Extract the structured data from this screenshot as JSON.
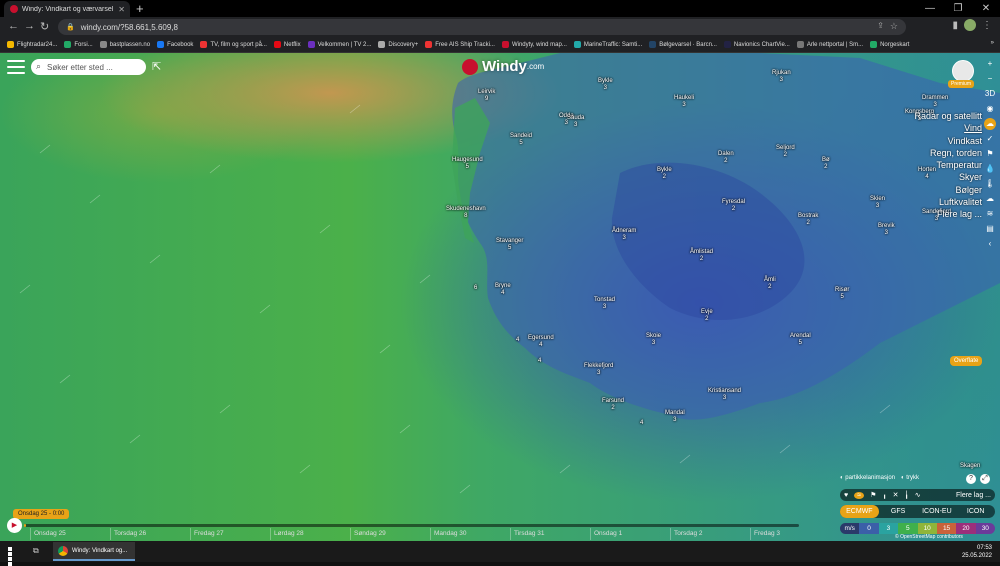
{
  "browser": {
    "tab_title": "Windy: Vindkart og værvarsel",
    "new_tab": "+",
    "url": "windy.com/?58.661,5.609,8",
    "window_controls": [
      "—",
      "❐",
      "✕"
    ],
    "bookmarks": [
      {
        "label": "Flightradar24...",
        "color": "#f5b800"
      },
      {
        "label": "Forsi...",
        "color": "#2a6"
      },
      {
        "label": "bastplassen.no",
        "color": "#888"
      },
      {
        "label": "Facebook",
        "color": "#1877f2"
      },
      {
        "label": "TV, film og sport på...",
        "color": "#e33"
      },
      {
        "label": "Netflix",
        "color": "#e50914"
      },
      {
        "label": "Velkommen | TV 2...",
        "color": "#6b2fbf"
      },
      {
        "label": "Discovery+",
        "color": "#aaa"
      },
      {
        "label": "Free AIS Ship Tracki...",
        "color": "#e33"
      },
      {
        "label": "Windyty, wind map...",
        "color": "#c8102e"
      },
      {
        "label": "MarineTraffic: Samti...",
        "color": "#2aa"
      },
      {
        "label": "Bølgevarsel · Barcn...",
        "color": "#246"
      },
      {
        "label": "Navionics ChartVie...",
        "color": "#224"
      },
      {
        "label": "Arle nettportal | Sm...",
        "color": "#777"
      },
      {
        "label": "Norgeskart",
        "color": "#2a6"
      }
    ],
    "other_bookmarks": "»"
  },
  "app": {
    "search_placeholder": "Søker etter sted ...",
    "logo_text": "Windy",
    "logo_suffix": ".com",
    "premium_label": "Premium",
    "menu": [
      "Radar og satellitt",
      "Vind",
      "Vindkast",
      "Regn, torden",
      "Temperatur",
      "Skyer",
      "Bølger",
      "Luftkvalitet",
      "Flere lag ..."
    ],
    "right_icons": [
      "+",
      "−",
      "3D",
      "◉",
      "☁",
      "✓",
      "⚑",
      "💧",
      "🌡",
      "☁",
      "≋",
      "▤",
      "‹"
    ],
    "overflate": "Overflate",
    "particle_label": "partikkelanimasjon",
    "pressure_label": "trykk",
    "layers_label": "Flere lag ...",
    "models": [
      "ECMWF",
      "GFS",
      "ICON-EU",
      "ICON"
    ],
    "selected_model": "ECMWF",
    "legend": {
      "unit": "m/s",
      "values": [
        "0",
        "3",
        "5",
        "10",
        "15",
        "20",
        "30"
      ],
      "colors": [
        "#3b5fa8",
        "#3b79c3",
        "#2aa3a0",
        "#3fb04c",
        "#c7b83a",
        "#c8623a",
        "#9b2f7b",
        "#6b3b9a"
      ]
    },
    "attribution": "© OpenStreetMap contributors",
    "timeline": {
      "current": "Onsdag 25 - 0:00",
      "days": [
        "Onsdag 25",
        "Torsdag 26",
        "Fredag 27",
        "Lørdag 28",
        "Søndag 29",
        "Mandag 30",
        "Tirsdag 31",
        "Onsdag 1",
        "Torsdag 2",
        "Fredag 3"
      ]
    }
  },
  "map_labels": [
    {
      "name": "Bykle",
      "val": "3"
    },
    {
      "name": "Rjukan",
      "val": "3"
    },
    {
      "name": "Haukeli",
      "val": "3"
    },
    {
      "name": "Leirvik",
      "val": "9"
    },
    {
      "name": "Odda",
      "val": "3"
    },
    {
      "name": "Sauda",
      "val": "3"
    },
    {
      "name": "Sandeid",
      "val": "5"
    },
    {
      "name": "Haugesund",
      "val": "5"
    },
    {
      "name": "Dalen",
      "val": "2"
    },
    {
      "name": "Seljord",
      "val": "2"
    },
    {
      "name": "Bø",
      "val": "2"
    },
    {
      "name": "Bykle",
      "val": "2"
    },
    {
      "name": "Skudeneshavn",
      "val": "8"
    },
    {
      "name": "Stavanger",
      "val": "5"
    },
    {
      "name": "Fyresdal",
      "val": "2"
    },
    {
      "name": "Bostrak",
      "val": "2"
    },
    {
      "name": "Skien",
      "val": "3"
    },
    {
      "name": "Ådneram",
      "val": "3"
    },
    {
      "name": "Åmlistad",
      "val": "2"
    },
    {
      "name": "Bryne",
      "val": "4"
    },
    {
      "name": "Åmli",
      "val": "2"
    },
    {
      "name": "Risør",
      "val": "5"
    },
    {
      "name": "Tonstad",
      "val": "3"
    },
    {
      "name": "Evje",
      "val": "2"
    },
    {
      "name": "Egersund",
      "val": "4"
    },
    {
      "name": "Arendal",
      "val": "5"
    },
    {
      "name": "Skoie",
      "val": "3"
    },
    {
      "name": "Flekkefjord",
      "val": "3"
    },
    {
      "name": "Kristiansand",
      "val": "3"
    },
    {
      "name": "Farsund",
      "val": "2"
    },
    {
      "name": "Mandal",
      "val": "3"
    },
    {
      "name": "Drammen",
      "val": "3"
    },
    {
      "name": "Kongsberg",
      "val": "3"
    },
    {
      "name": "Horten",
      "val": "4"
    },
    {
      "name": "Sandefjord",
      "val": "3"
    },
    {
      "name": "Brevik",
      "val": "3"
    },
    {
      "name": "Skagen",
      "val": ""
    }
  ],
  "sea_values": [
    "6",
    "4",
    "4",
    "4"
  ],
  "taskbar": {
    "app_label": "Windy: Vindkart og...",
    "time": "07:53",
    "date": "25.05.2022"
  }
}
